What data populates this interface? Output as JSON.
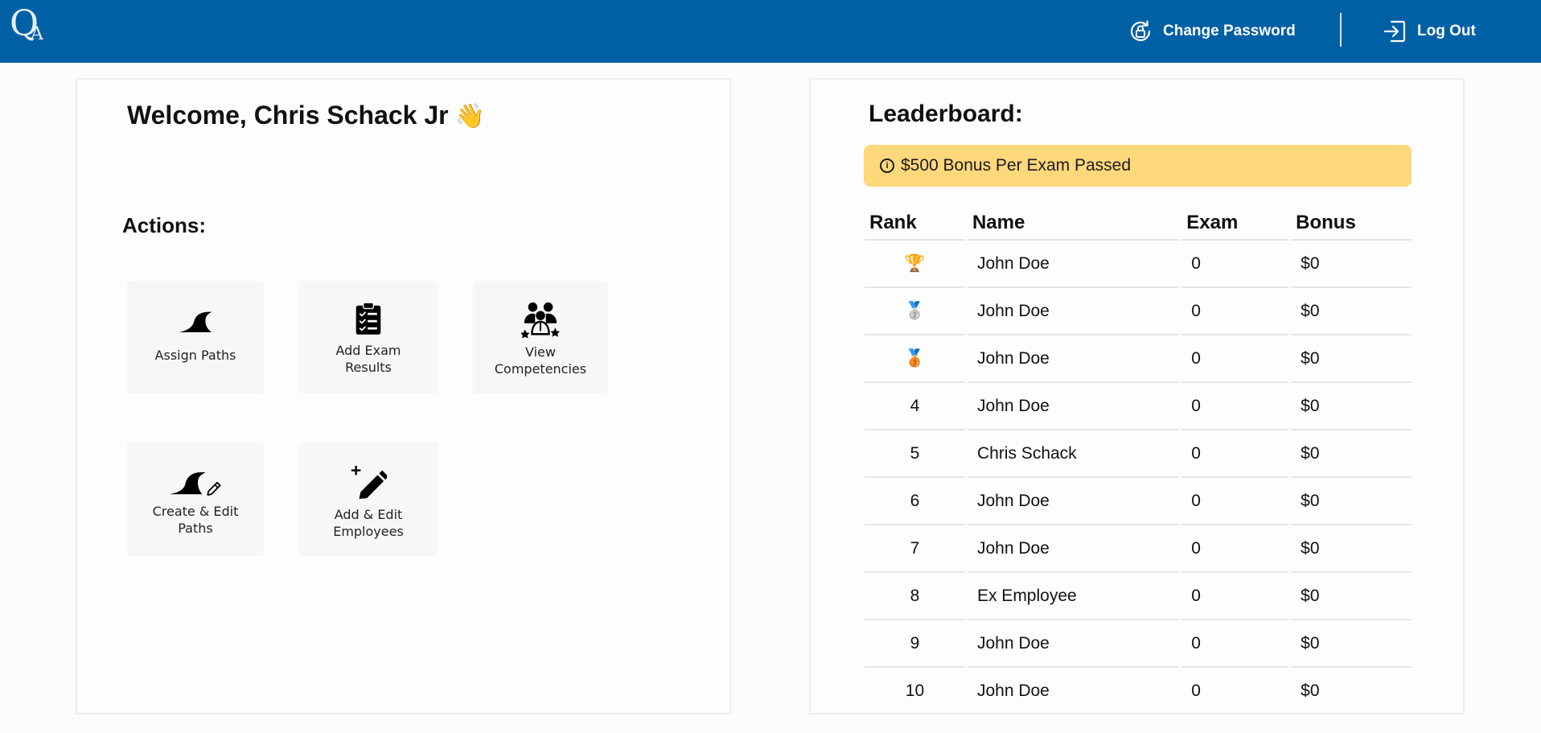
{
  "header": {
    "logo_q": "Q",
    "logo_a": "A",
    "change_password": "Change Password",
    "log_out": "Log Out"
  },
  "welcome": {
    "text": "Welcome, Chris Schack Jr",
    "emoji": "👋"
  },
  "actions": {
    "title": "Actions:",
    "assign_paths": "Assign Paths",
    "add_exam_1": "Add Exam",
    "add_exam_2": "Results",
    "view_comp_1": "View",
    "view_comp_2": "Competencies",
    "create_paths_1": "Create & Edit",
    "create_paths_2": "Paths",
    "add_emp_1": "Add & Edit",
    "add_emp_2": "Employees"
  },
  "leaderboard": {
    "title": "Leaderboard:",
    "bonus_note": "$500 Bonus Per Exam Passed",
    "columns": [
      "Rank",
      "Name",
      "Exam",
      "Bonus"
    ],
    "rows": [
      {
        "rank": "🏆",
        "name": "John Doe",
        "exam": "0",
        "bonus": "$0"
      },
      {
        "rank": "🥈",
        "name": "John Doe",
        "exam": "0",
        "bonus": "$0"
      },
      {
        "rank": "🥉",
        "name": "John Doe",
        "exam": "0",
        "bonus": "$0"
      },
      {
        "rank": "4",
        "name": "John Doe",
        "exam": "0",
        "bonus": "$0"
      },
      {
        "rank": "5",
        "name": "Chris Schack",
        "exam": "0",
        "bonus": "$0"
      },
      {
        "rank": "6",
        "name": "John Doe",
        "exam": "0",
        "bonus": "$0"
      },
      {
        "rank": "7",
        "name": "John Doe",
        "exam": "0",
        "bonus": "$0"
      },
      {
        "rank": "8",
        "name": "Ex Employee",
        "exam": "0",
        "bonus": "$0"
      },
      {
        "rank": "9",
        "name": "John Doe",
        "exam": "0",
        "bonus": "$0"
      },
      {
        "rank": "10",
        "name": "John Doe",
        "exam": "0",
        "bonus": "$0"
      }
    ]
  },
  "colors": {
    "header_bg": "#0060a6",
    "bonus_bg": "#ffd87c"
  }
}
